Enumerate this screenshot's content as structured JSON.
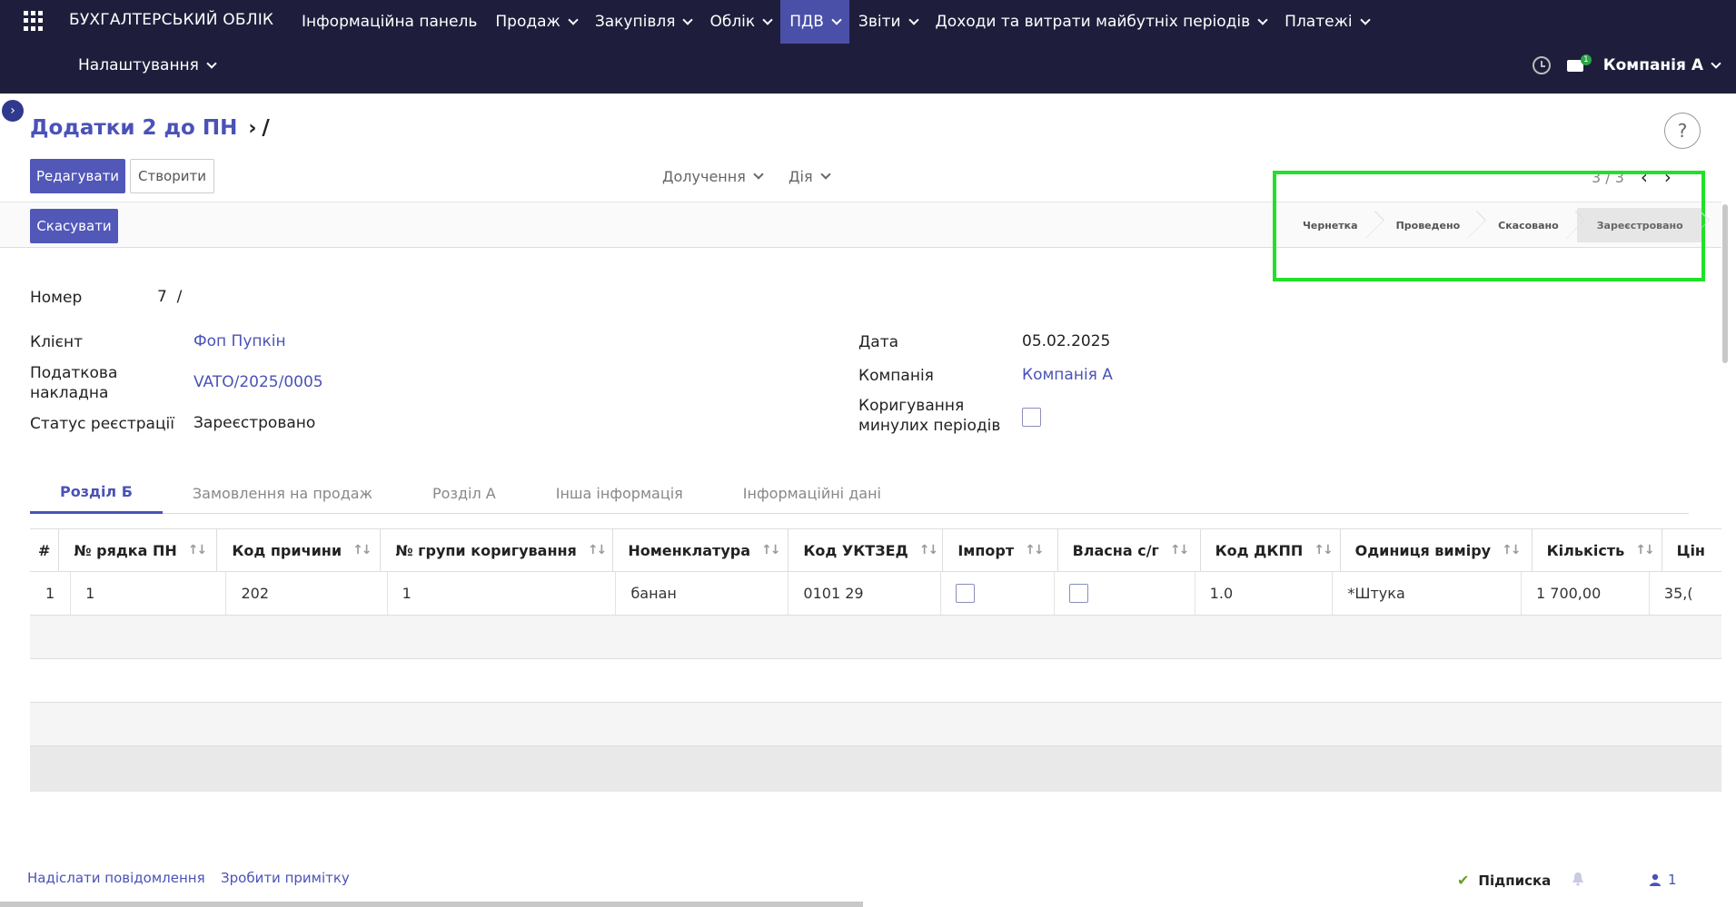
{
  "topnav": {
    "brand": "БУХГАЛТЕРСЬКИЙ ОБЛІК",
    "menu": [
      {
        "label": "Інформаційна панель",
        "dropdown": false
      },
      {
        "label": "Продаж",
        "dropdown": true
      },
      {
        "label": "Закупівля",
        "dropdown": true
      },
      {
        "label": "Облік",
        "dropdown": true
      },
      {
        "label": "ПДВ",
        "dropdown": true,
        "active": true
      },
      {
        "label": "Звіти",
        "dropdown": true
      },
      {
        "label": "Доходи та витрати майбутніх періодів",
        "dropdown": true
      },
      {
        "label": "Платежі",
        "dropdown": true
      }
    ],
    "settings": "Налаштування",
    "chat_badge": "1",
    "company": "Компанія А"
  },
  "breadcrumb": {
    "parent": "Додатки 2 до ПН",
    "current": "/"
  },
  "control": {
    "edit": "Редагувати",
    "create": "Створити",
    "attachments": "Долучення",
    "action": "Дія",
    "pager": "3 / 3",
    "cancel": "Скасувати"
  },
  "statusbar": {
    "stages": [
      "Чернетка",
      "Проведено",
      "Скасовано",
      "Зареєстровано"
    ],
    "current": "Зареєстровано"
  },
  "form": {
    "number_label": "Номер",
    "number_value": "7  /",
    "client_label": "Клієнт",
    "client_value": "Фоп Пупкін",
    "invoice_label": "Податкова накладна",
    "invoice_value": "VATO/2025/0005",
    "reg_status_label": "Статус реєстрації",
    "reg_status_value": "Зареєстровано",
    "date_label": "Дата",
    "date_value": "05.02.2025",
    "company_label": "Компанія",
    "company_value": "Компанія А",
    "correction_label": "Коригування минулих періодів",
    "correction_checked": false
  },
  "tabs": [
    "Розділ Б",
    "Замовлення на продаж",
    "Розділ А",
    "Інша інформація",
    "Інформаційні дані"
  ],
  "table": {
    "columns": [
      "#",
      "№ рядка ПН",
      "Код причини",
      "№ групи коригування",
      "Номенклатура",
      "Код УКТЗЕД",
      "Імпорт",
      "Власна с/г",
      "Код ДКПП",
      "Одиниця виміру",
      "Кількість",
      "Цін"
    ],
    "rows": [
      [
        "1",
        "1",
        "202",
        "1",
        "банан",
        "0101 29",
        "",
        "",
        "1.0",
        "*Штука",
        "1 700,00",
        "35,("
      ]
    ]
  },
  "footer": {
    "send_message": "Надіслати повідомлення",
    "log_note": "Зробити примітку",
    "follow": "Підписка",
    "followers": "1"
  }
}
